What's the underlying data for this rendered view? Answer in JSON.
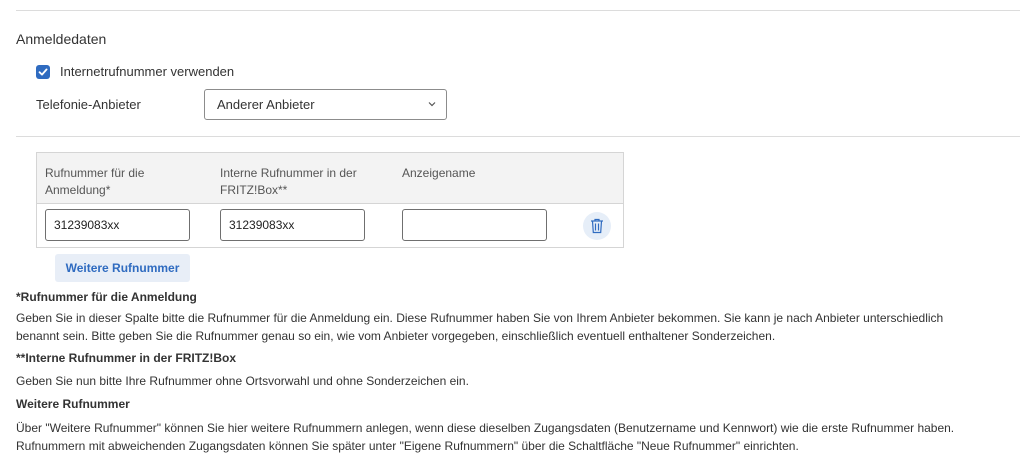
{
  "section": {
    "title": "Anmeldedaten"
  },
  "checkbox": {
    "label": "Internetrufnummer verwenden",
    "checked": true
  },
  "provider": {
    "label": "Telefonie-Anbieter",
    "selected": "Anderer Anbieter"
  },
  "table": {
    "headers": [
      "Rufnummer für die Anmeldung*",
      "Interne Rufnummer in der FRITZ!Box**",
      "Anzeigename"
    ],
    "row": {
      "login_number": "31239083xx",
      "internal_number": "31239083xx",
      "display_name": ""
    }
  },
  "buttons": {
    "more_numbers": "Weitere Rufnummer"
  },
  "info": {
    "h1": "*Rufnummer für die Anmeldung",
    "p1a": "Geben Sie in dieser Spalte bitte die Rufnummer für die Anmeldung ein. Diese Rufnummer haben Sie von Ihrem Anbieter bekommen. Sie kann je nach Anbieter unterschiedlich",
    "p1b": "benannt sein. Bitte geben Sie die Rufnummer genau so ein, wie vom Anbieter vorgegeben, einschließlich eventuell enthaltener Sonderzeichen.",
    "h2": "**Interne Rufnummer in der FRITZ!Box",
    "p2": "Geben Sie nun bitte Ihre Rufnummer ohne Ortsvorwahl und ohne Sonderzeichen ein.",
    "h3": "Weitere Rufnummer",
    "p3a": "Über \"Weitere Rufnummer\" können Sie hier weitere Rufnummern anlegen, wenn diese dieselben Zugangsdaten (Benutzername und Kennwort) wie die erste Rufnummer haben.",
    "p3b": "Rufnummern mit abweichenden Zugangsdaten können Sie später unter \"Eigene Rufnummern\" über die Schaltfläche \"Neue Rufnummer\" einrichten."
  },
  "colors": {
    "accent": "#2f6bc0",
    "button_bg": "#e8eef7",
    "header_bg": "#f3f3f3"
  }
}
